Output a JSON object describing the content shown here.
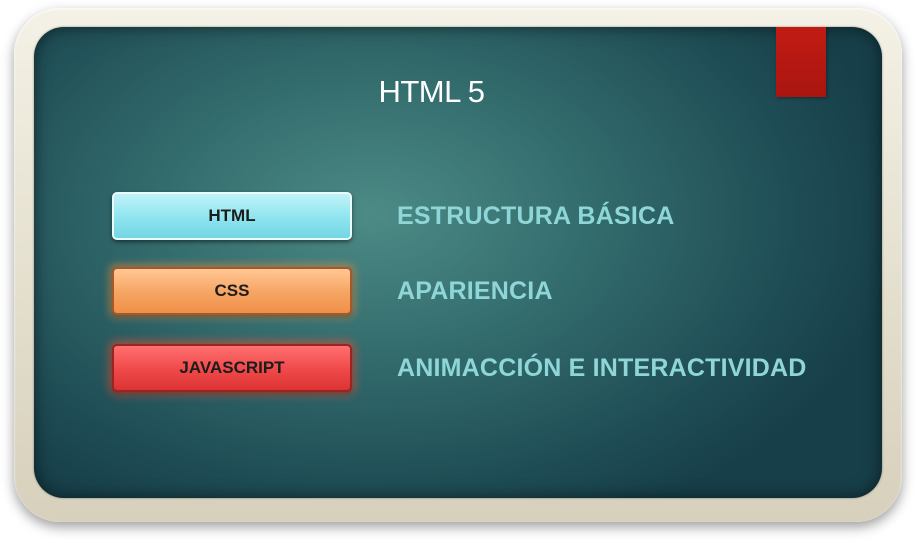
{
  "slide": {
    "title": "HTML 5",
    "colors": {
      "frame": "#e4dfcd",
      "board": "#31696b",
      "corner_tab": "#b8180f",
      "description_text": "#8fd6d8"
    },
    "rows": [
      {
        "label": "HTML",
        "description": "ESTRUCTURA BÁSICA",
        "color": "#8ee4ef"
      },
      {
        "label": "CSS",
        "description": "APARIENCIA",
        "color": "#f6a462"
      },
      {
        "label": "JAVASCRIPT",
        "description": "ANIMACCIÓN E INTERACTIVIDAD",
        "color": "#ef4848"
      }
    ]
  }
}
